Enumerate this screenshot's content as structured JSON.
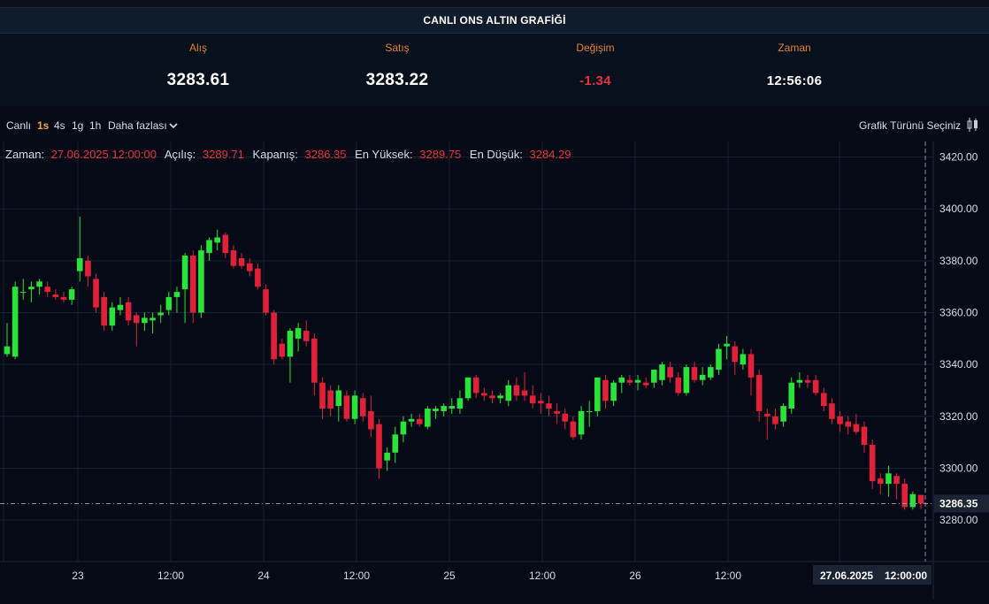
{
  "header": {
    "title": "CANLI ONS ALTIN GRAFİĞİ"
  },
  "quotes": [
    {
      "label": "Alış",
      "value": "3283.61",
      "style": "big"
    },
    {
      "label": "Satış",
      "value": "3283.22",
      "style": "big"
    },
    {
      "label": "Değişim",
      "value": "-1.34",
      "style": "neg"
    },
    {
      "label": "Zaman",
      "value": "12:56:06",
      "style": "small"
    }
  ],
  "toolbar": {
    "live_label": "Canlı",
    "timeframes": [
      "1s",
      "4s",
      "1g",
      "1h"
    ],
    "active_timeframe": "1s",
    "more_label": "Daha fazlası",
    "chart_type_label": "Grafik Türünü Seçiniz"
  },
  "ohlc_legend": {
    "time_label": "Zaman:",
    "time_value": "27.06.2025 12:00:00",
    "open_label": "Açılış:",
    "open_value": "3289.71",
    "close_label": "Kapanış:",
    "close_value": "3286.35",
    "high_label": "En Yüksek:",
    "high_value": "3289.75",
    "low_label": "En Düşük:",
    "low_value": "3284.29"
  },
  "chart_data": {
    "type": "candlestick",
    "title": "",
    "xlabel": "",
    "ylabel": "",
    "ylim": [
      3264,
      3426
    ],
    "y_ticks": [
      "3420.00",
      "3400.00",
      "3380.00",
      "3360.00",
      "3340.00",
      "3320.00",
      "3300.00",
      "3280.00"
    ],
    "x_ticks": [
      "23",
      "12:00",
      "24",
      "12:00",
      "25",
      "12:00",
      "26",
      "12:00"
    ],
    "crosshair": {
      "price_label": "3286.35",
      "date_label": "27.06.2025",
      "time_label": "12:00:00"
    },
    "colors": {
      "up": "#29e23a",
      "down": "#e3203a"
    },
    "candles": [
      {
        "o": 3344,
        "h": 3356,
        "l": 3343,
        "c": 3347
      },
      {
        "o": 3343,
        "h": 3372,
        "l": 3342,
        "c": 3370
      },
      {
        "o": 3368,
        "h": 3373,
        "l": 3365,
        "c": 3368
      },
      {
        "o": 3369,
        "h": 3372,
        "l": 3364,
        "c": 3370
      },
      {
        "o": 3370,
        "h": 3373,
        "l": 3367,
        "c": 3372
      },
      {
        "o": 3370,
        "h": 3372,
        "l": 3366,
        "c": 3368
      },
      {
        "o": 3367,
        "h": 3369,
        "l": 3365,
        "c": 3366
      },
      {
        "o": 3366,
        "h": 3368,
        "l": 3364,
        "c": 3365
      },
      {
        "o": 3365,
        "h": 3370,
        "l": 3363,
        "c": 3369
      },
      {
        "o": 3376,
        "h": 3397,
        "l": 3372,
        "c": 3381
      },
      {
        "o": 3380,
        "h": 3382,
        "l": 3370,
        "c": 3374
      },
      {
        "o": 3373,
        "h": 3375,
        "l": 3360,
        "c": 3362
      },
      {
        "o": 3366,
        "h": 3368,
        "l": 3353,
        "c": 3355
      },
      {
        "o": 3355,
        "h": 3364,
        "l": 3353,
        "c": 3362
      },
      {
        "o": 3361,
        "h": 3366,
        "l": 3359,
        "c": 3363
      },
      {
        "o": 3364,
        "h": 3366,
        "l": 3355,
        "c": 3357
      },
      {
        "o": 3359,
        "h": 3360,
        "l": 3347,
        "c": 3356
      },
      {
        "o": 3356,
        "h": 3360,
        "l": 3353,
        "c": 3358
      },
      {
        "o": 3357,
        "h": 3360,
        "l": 3352,
        "c": 3358
      },
      {
        "o": 3359,
        "h": 3363,
        "l": 3356,
        "c": 3360
      },
      {
        "o": 3361,
        "h": 3368,
        "l": 3359,
        "c": 3366
      },
      {
        "o": 3366,
        "h": 3370,
        "l": 3360,
        "c": 3368
      },
      {
        "o": 3369,
        "h": 3383,
        "l": 3356,
        "c": 3382
      },
      {
        "o": 3382,
        "h": 3384,
        "l": 3356,
        "c": 3360
      },
      {
        "o": 3360,
        "h": 3386,
        "l": 3358,
        "c": 3384
      },
      {
        "o": 3383,
        "h": 3389,
        "l": 3380,
        "c": 3388
      },
      {
        "o": 3387,
        "h": 3392,
        "l": 3384,
        "c": 3389
      },
      {
        "o": 3390,
        "h": 3391,
        "l": 3381,
        "c": 3383
      },
      {
        "o": 3384,
        "h": 3386,
        "l": 3377,
        "c": 3378
      },
      {
        "o": 3381,
        "h": 3383,
        "l": 3377,
        "c": 3378
      },
      {
        "o": 3379,
        "h": 3381,
        "l": 3374,
        "c": 3376
      },
      {
        "o": 3377,
        "h": 3379,
        "l": 3369,
        "c": 3370
      },
      {
        "o": 3369,
        "h": 3371,
        "l": 3359,
        "c": 3360
      },
      {
        "o": 3360,
        "h": 3361,
        "l": 3340,
        "c": 3342
      },
      {
        "o": 3348,
        "h": 3350,
        "l": 3342,
        "c": 3343
      },
      {
        "o": 3343,
        "h": 3354,
        "l": 3333,
        "c": 3353
      },
      {
        "o": 3350,
        "h": 3356,
        "l": 3345,
        "c": 3354
      },
      {
        "o": 3353,
        "h": 3357,
        "l": 3347,
        "c": 3349
      },
      {
        "o": 3350,
        "h": 3352,
        "l": 3328,
        "c": 3333
      },
      {
        "o": 3333,
        "h": 3335,
        "l": 3319,
        "c": 3323
      },
      {
        "o": 3330,
        "h": 3332,
        "l": 3320,
        "c": 3323
      },
      {
        "o": 3324,
        "h": 3332,
        "l": 3318,
        "c": 3330
      },
      {
        "o": 3328,
        "h": 3330,
        "l": 3318,
        "c": 3319
      },
      {
        "o": 3319,
        "h": 3330,
        "l": 3317,
        "c": 3328
      },
      {
        "o": 3327,
        "h": 3329,
        "l": 3318,
        "c": 3320
      },
      {
        "o": 3322,
        "h": 3328,
        "l": 3312,
        "c": 3315
      },
      {
        "o": 3317,
        "h": 3319,
        "l": 3296,
        "c": 3300
      },
      {
        "o": 3303,
        "h": 3308,
        "l": 3299,
        "c": 3306
      },
      {
        "o": 3306,
        "h": 3316,
        "l": 3302,
        "c": 3313
      },
      {
        "o": 3313,
        "h": 3320,
        "l": 3310,
        "c": 3318
      },
      {
        "o": 3318,
        "h": 3321,
        "l": 3316,
        "c": 3319
      },
      {
        "o": 3319,
        "h": 3321,
        "l": 3316,
        "c": 3317
      },
      {
        "o": 3316,
        "h": 3324,
        "l": 3315,
        "c": 3323
      },
      {
        "o": 3322,
        "h": 3324,
        "l": 3319,
        "c": 3323
      },
      {
        "o": 3322,
        "h": 3325,
        "l": 3320,
        "c": 3324
      },
      {
        "o": 3323,
        "h": 3327,
        "l": 3321,
        "c": 3324
      },
      {
        "o": 3323,
        "h": 3330,
        "l": 3321,
        "c": 3327
      },
      {
        "o": 3327,
        "h": 3335,
        "l": 3326,
        "c": 3335
      },
      {
        "o": 3335,
        "h": 3336,
        "l": 3327,
        "c": 3329
      },
      {
        "o": 3329,
        "h": 3331,
        "l": 3326,
        "c": 3328
      },
      {
        "o": 3328,
        "h": 3330,
        "l": 3325,
        "c": 3327
      },
      {
        "o": 3327,
        "h": 3329,
        "l": 3325,
        "c": 3328
      },
      {
        "o": 3326,
        "h": 3334,
        "l": 3324,
        "c": 3332
      },
      {
        "o": 3332,
        "h": 3335,
        "l": 3326,
        "c": 3328
      },
      {
        "o": 3330,
        "h": 3337,
        "l": 3326,
        "c": 3328
      },
      {
        "o": 3328,
        "h": 3332,
        "l": 3323,
        "c": 3325
      },
      {
        "o": 3326,
        "h": 3329,
        "l": 3321,
        "c": 3325
      },
      {
        "o": 3325,
        "h": 3328,
        "l": 3320,
        "c": 3323
      },
      {
        "o": 3322,
        "h": 3325,
        "l": 3317,
        "c": 3321
      },
      {
        "o": 3321,
        "h": 3323,
        "l": 3315,
        "c": 3318
      },
      {
        "o": 3318,
        "h": 3320,
        "l": 3311,
        "c": 3312
      },
      {
        "o": 3313,
        "h": 3324,
        "l": 3311,
        "c": 3322
      },
      {
        "o": 3322,
        "h": 3326,
        "l": 3316,
        "c": 3322
      },
      {
        "o": 3322,
        "h": 3335,
        "l": 3320,
        "c": 3335
      },
      {
        "o": 3334,
        "h": 3336,
        "l": 3323,
        "c": 3326
      },
      {
        "o": 3326,
        "h": 3334,
        "l": 3324,
        "c": 3333
      },
      {
        "o": 3333,
        "h": 3336,
        "l": 3329,
        "c": 3335
      },
      {
        "o": 3334,
        "h": 3336,
        "l": 3332,
        "c": 3333
      },
      {
        "o": 3333,
        "h": 3336,
        "l": 3330,
        "c": 3334
      },
      {
        "o": 3333,
        "h": 3335,
        "l": 3331,
        "c": 3332
      },
      {
        "o": 3333,
        "h": 3338,
        "l": 3331,
        "c": 3338
      },
      {
        "o": 3334,
        "h": 3341,
        "l": 3332,
        "c": 3340
      },
      {
        "o": 3339,
        "h": 3341,
        "l": 3333,
        "c": 3335
      },
      {
        "o": 3335,
        "h": 3337,
        "l": 3328,
        "c": 3329
      },
      {
        "o": 3329,
        "h": 3340,
        "l": 3328,
        "c": 3339
      },
      {
        "o": 3339,
        "h": 3341,
        "l": 3333,
        "c": 3334
      },
      {
        "o": 3334,
        "h": 3339,
        "l": 3332,
        "c": 3336
      },
      {
        "o": 3335,
        "h": 3340,
        "l": 3334,
        "c": 3339
      },
      {
        "o": 3338,
        "h": 3348,
        "l": 3336,
        "c": 3346
      },
      {
        "o": 3347,
        "h": 3351,
        "l": 3342,
        "c": 3348
      },
      {
        "o": 3347,
        "h": 3349,
        "l": 3336,
        "c": 3341
      },
      {
        "o": 3340,
        "h": 3346,
        "l": 3338,
        "c": 3344
      },
      {
        "o": 3344,
        "h": 3346,
        "l": 3328,
        "c": 3335
      },
      {
        "o": 3336,
        "h": 3338,
        "l": 3318,
        "c": 3322
      },
      {
        "o": 3321,
        "h": 3323,
        "l": 3311,
        "c": 3320
      },
      {
        "o": 3320,
        "h": 3323,
        "l": 3315,
        "c": 3317
      },
      {
        "o": 3318,
        "h": 3325,
        "l": 3316,
        "c": 3324
      },
      {
        "o": 3323,
        "h": 3335,
        "l": 3321,
        "c": 3333
      },
      {
        "o": 3333,
        "h": 3337,
        "l": 3331,
        "c": 3334
      },
      {
        "o": 3334,
        "h": 3336,
        "l": 3331,
        "c": 3333
      },
      {
        "o": 3334,
        "h": 3336,
        "l": 3328,
        "c": 3329
      },
      {
        "o": 3329,
        "h": 3331,
        "l": 3322,
        "c": 3324
      },
      {
        "o": 3325,
        "h": 3327,
        "l": 3317,
        "c": 3319
      },
      {
        "o": 3320,
        "h": 3322,
        "l": 3314,
        "c": 3317
      },
      {
        "o": 3318,
        "h": 3320,
        "l": 3313,
        "c": 3316
      },
      {
        "o": 3317,
        "h": 3321,
        "l": 3313,
        "c": 3314
      },
      {
        "o": 3316,
        "h": 3318,
        "l": 3306,
        "c": 3309
      },
      {
        "o": 3309,
        "h": 3311,
        "l": 3292,
        "c": 3295
      },
      {
        "o": 3296,
        "h": 3298,
        "l": 3290,
        "c": 3294
      },
      {
        "o": 3294,
        "h": 3301,
        "l": 3289,
        "c": 3298
      },
      {
        "o": 3297,
        "h": 3298,
        "l": 3288,
        "c": 3294
      },
      {
        "o": 3294,
        "h": 3296,
        "l": 3284,
        "c": 3285
      },
      {
        "o": 3285,
        "h": 3291,
        "l": 3284,
        "c": 3290
      },
      {
        "o": 3289.71,
        "h": 3289.75,
        "l": 3284.29,
        "c": 3286.35
      }
    ]
  }
}
